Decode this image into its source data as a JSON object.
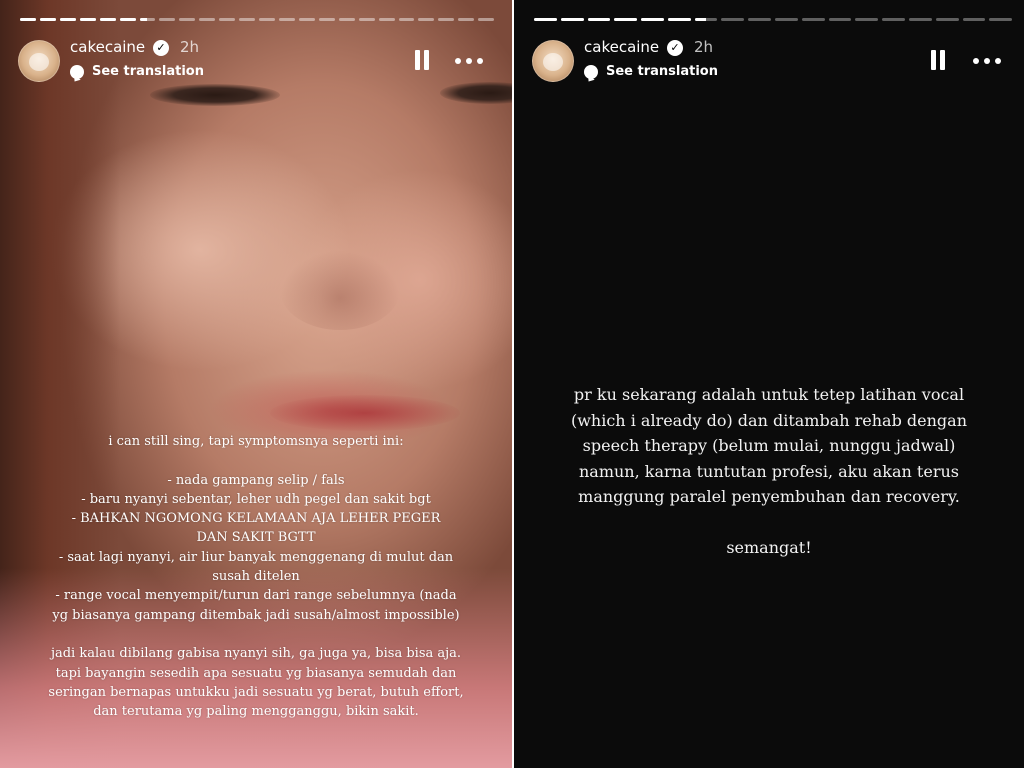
{
  "stories": [
    {
      "username": "cakecaine",
      "time_ago": "2h",
      "see_translation": "See translation",
      "progress_segments": 24,
      "progress_filled": 6.5,
      "text": "i can still sing, tapi symptomsnya seperti ini:\n\n- nada gampang selip / fals\n- baru nyanyi sebentar, leher udh pegel dan sakit bgt\n- BAHKAN NGOMONG KELAMAAN AJA LEHER PEGER\nDAN SAKIT BGTT\n- saat lagi nyanyi, air liur banyak menggenang di mulut dan\nsusah ditelen\n- range vocal menyempit/turun dari range sebelumnya (nada\nyg biasanya gampang ditembak jadi susah/almost impossible)\n\njadi kalau dibilang gabisa nyanyi sih, ga juga ya, bisa bisa aja.\ntapi bayangin sesedih apa sesuatu yg biasanya semudah dan\nseringan bernapas untukku jadi sesuatu yg berat, butuh effort,\ndan terutama yg paling mengganggu, bikin sakit."
    },
    {
      "username": "cakecaine",
      "time_ago": "2h",
      "see_translation": "See translation",
      "progress_segments": 18,
      "progress_filled": 6.5,
      "text": "pr ku sekarang adalah untuk tetep latihan vocal\n(which i already do) dan ditambah rehab dengan\nspeech therapy (belum mulai, nunggu jadwal)\nnamun, karna tuntutan profesi, aku akan terus\nmanggung paralel penyembuhan dan recovery.\n\nsemangat!"
    }
  ],
  "icons": {
    "verified": "verified-badge-icon",
    "translation": "translate-bubble-icon",
    "pause": "pause-icon",
    "more": "more-options-icon"
  }
}
